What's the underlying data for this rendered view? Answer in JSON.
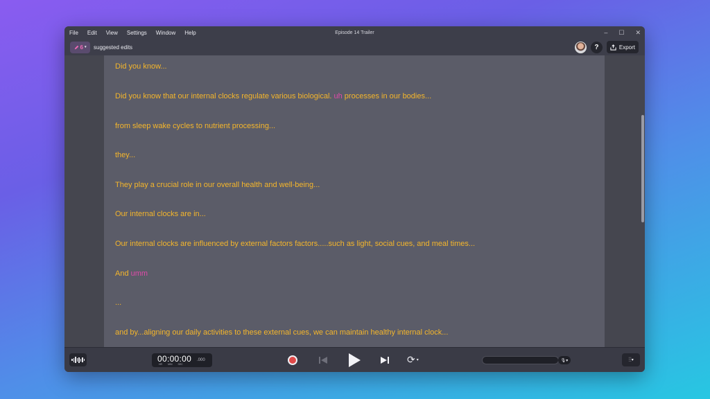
{
  "window": {
    "title": "Episode 14 Trailer",
    "menu": [
      "File",
      "Edit",
      "View",
      "Settings",
      "Window",
      "Help"
    ],
    "controls": {
      "minimize": "–",
      "maximize": "☐",
      "close": "✕"
    }
  },
  "toolbar": {
    "edits_count": "6",
    "edits_label": "suggested edits",
    "help_label": "?",
    "export_label": "Export"
  },
  "transcript": {
    "lines": [
      {
        "text": "Did you know...",
        "filler": "",
        "after": ""
      },
      {
        "text": "Did you know that our internal clocks regulate various biological. ",
        "filler": "uh",
        "after": " processes in our bodies..."
      },
      {
        "text": "from sleep wake cycles to nutrient processing...",
        "filler": "",
        "after": ""
      },
      {
        "text": "they...",
        "filler": "",
        "after": ""
      },
      {
        "text": "They play a crucial role in our overall health and well-being...",
        "filler": "",
        "after": ""
      },
      {
        "text": "Our internal clocks are in...",
        "filler": "",
        "after": ""
      },
      {
        "text": "Our internal clocks are influenced by external factors factors.....such as light, social cues, and meal times...",
        "filler": "",
        "after": ""
      },
      {
        "text": "And ",
        "filler": "umm",
        "after": ""
      },
      {
        "text": "...",
        "filler": "",
        "after": ""
      },
      {
        "text": "and by...aligning our daily activities to these external cues, we can maintain healthy internal clock...",
        "filler": "",
        "after": ""
      }
    ]
  },
  "transport": {
    "timecode": "00:00:00",
    "timecode_ms": ".000",
    "units": [
      "HR",
      "MIN",
      "SEC"
    ],
    "loop_caret": "▾",
    "mic_caret": "▾",
    "mixer_caret": "▾"
  },
  "colors": {
    "transcript_text": "#f5b62b",
    "filler_word": "#e04aa9",
    "record": "#e04a4a"
  }
}
